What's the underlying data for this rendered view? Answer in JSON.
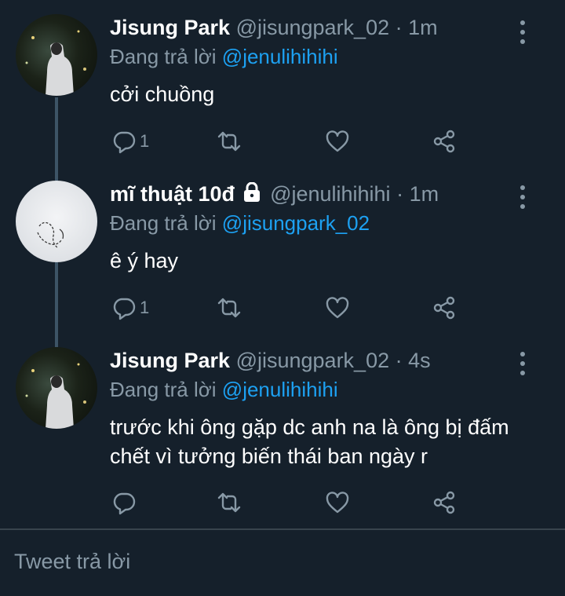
{
  "tweets": [
    {
      "name": "Jisung Park",
      "handle": "@jisungpark_02",
      "sep": "·",
      "time": "1m",
      "locked": false,
      "reply_prefix": "Đang trả lời",
      "reply_to": "@jenulihihihi",
      "text": "cởi chuồng",
      "reply_count": "1",
      "avatar": "dark-night-photo"
    },
    {
      "name": "mĩ thuật 10đ",
      "handle": "@jenulihihihi",
      "sep": "·",
      "time": "1m",
      "locked": true,
      "reply_prefix": "Đang trả lời",
      "reply_to": "@jisungpark_02",
      "text": "ê ý hay",
      "reply_count": "1",
      "avatar": "light-sketch"
    },
    {
      "name": "Jisung Park",
      "handle": "@jisungpark_02",
      "sep": "·",
      "time": "4s",
      "locked": false,
      "reply_prefix": "Đang trả lời",
      "reply_to": "@jenulihihihi",
      "text": "trước khi ông gặp dc anh na là ông bị đấm chết vì tưởng biến thái ban ngày r",
      "reply_count": "",
      "avatar": "dark-night-photo"
    }
  ],
  "compose": {
    "placeholder": "Tweet trả lời"
  },
  "colors": {
    "background": "#15202b",
    "muted": "#8899a6",
    "accent": "#1da1f2",
    "thread_line": "#3d5466"
  },
  "icons": [
    "reply-icon",
    "retweet-icon",
    "like-icon",
    "share-icon",
    "more-options-icon",
    "lock-icon"
  ]
}
